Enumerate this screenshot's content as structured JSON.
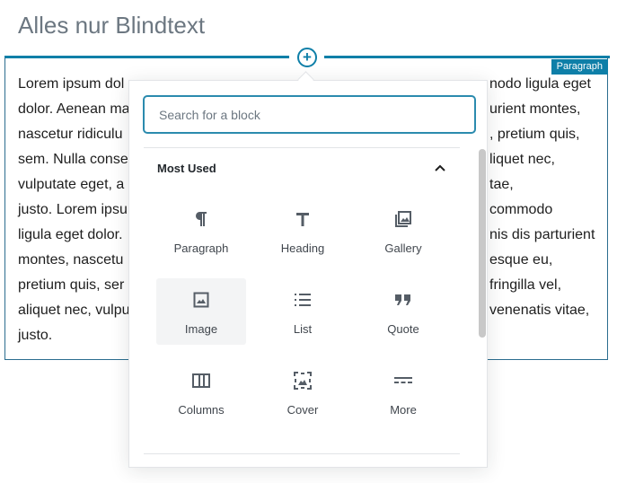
{
  "post": {
    "title": "Alles nur Blindtext"
  },
  "paragraph": {
    "badge": "Paragraph",
    "lines_left": [
      "Lorem ipsum dol",
      "dolor. Aenean ma",
      "nascetur ridiculu",
      "sem. Nulla conse",
      "vulputate eget, a",
      "justo. Lorem ipsu",
      "ligula eget dolor.",
      "montes, nascetu",
      "pretium quis, ser",
      "aliquet nec, vulpu",
      "justo."
    ],
    "lines_right": [
      "nodo ligula eget",
      "urient montes,",
      ", pretium quis,",
      "liquet nec,",
      "tae,",
      "commodo",
      "nis dis parturient",
      "esque eu,",
      "fringilla vel,",
      "venenatis vitae,",
      ""
    ]
  },
  "inserter": {
    "search_placeholder": "Search for a block",
    "panel_title": "Most Used",
    "blocks": [
      {
        "label": "Paragraph",
        "icon": "paragraph-icon"
      },
      {
        "label": "Heading",
        "icon": "heading-icon"
      },
      {
        "label": "Gallery",
        "icon": "gallery-icon"
      },
      {
        "label": "Image",
        "icon": "image-icon"
      },
      {
        "label": "List",
        "icon": "list-icon"
      },
      {
        "label": "Quote",
        "icon": "quote-icon"
      },
      {
        "label": "Columns",
        "icon": "columns-icon"
      },
      {
        "label": "Cover",
        "icon": "cover-icon"
      },
      {
        "label": "More",
        "icon": "more-icon"
      }
    ]
  },
  "colors": {
    "accent": "#0e7fa8",
    "icon": "#555d66"
  }
}
